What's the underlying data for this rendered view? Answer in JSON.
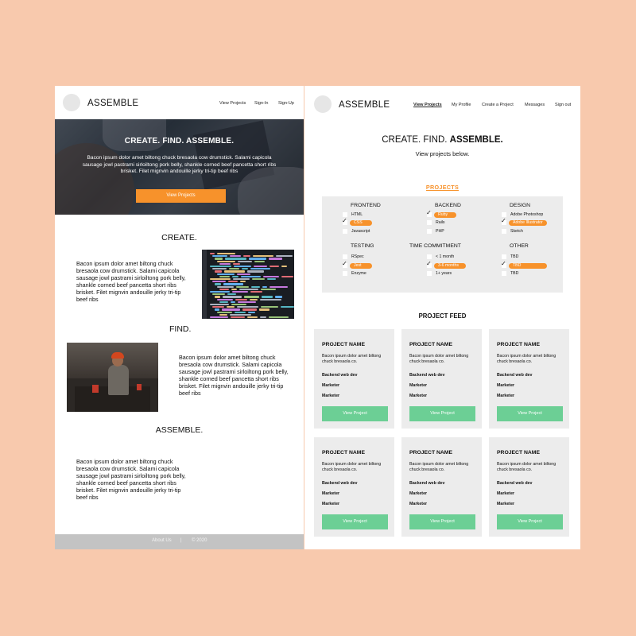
{
  "left": {
    "brand": "ASSEMBLE",
    "nav": [
      "View Projects",
      "Sign-In",
      "Sign-Up"
    ],
    "hero": {
      "title": "CREATE. FIND. ASSEMBLE.",
      "text": "Bacon ipsum dolor amet biltong chuck bresaola cow drumstick. Salami capicola sausage jowl pastrami sirloiltong pork belly, shankle corned beef pancetta short ribs brisket. Filet mignvin andouille jerky tri-tip beef ribs",
      "button": "View Projects"
    },
    "sections": [
      {
        "title": "CREATE.",
        "text": "Bacon ipsum dolor amet biltong chuck bresaola cow drumstick. Salami capicola sausage jowl pastrami sirloiltong pork belly, shankle corned beef pancetta short ribs brisket. Filet mignvin andouille jerky tri-tip beef ribs"
      },
      {
        "title": "FIND.",
        "text": "Bacon ipsum dolor amet biltong chuck bresaola cow drumstick. Salami capicola sausage jowl pastrami sirloiltong pork belly, shankle corned beef pancetta short ribs brisket. Filet mignvin andouille jerky tri-tip beef ribs"
      },
      {
        "title": "ASSEMBLE.",
        "text": "Bacon ipsum dolor amet biltong chuck bresaola cow drumstick. Salami capicola sausage jowl pastrami sirloiltong pork belly, shankle corned beef pancetta short ribs brisket. Filet mignvin andouille jerky tri-tip beef ribs"
      }
    ],
    "footer": {
      "about": "About Us",
      "sep": "|",
      "copyright": "© 2020"
    }
  },
  "right": {
    "brand": "ASSEMBLE",
    "nav": [
      "View Projects",
      "My Profile",
      "Create a Project",
      "Messages",
      "Sign out"
    ],
    "title_plain": "CREATE. FIND.",
    "title_bold": "ASSEMBLE.",
    "subtitle": "View projects below.",
    "projects_label": "PROJECTS",
    "filters": [
      {
        "heading": "FRONTEND",
        "options": [
          {
            "label": "HTML",
            "checked": false
          },
          {
            "label": "CSS",
            "checked": true
          },
          {
            "label": "Javascript",
            "checked": false
          }
        ]
      },
      {
        "heading": "BACKEND",
        "options": [
          {
            "label": "Ruby",
            "checked": true
          },
          {
            "label": "Rails",
            "checked": false
          },
          {
            "label": "PHP",
            "checked": false
          }
        ]
      },
      {
        "heading": "DESIGN",
        "options": [
          {
            "label": "Adobe Photoshop",
            "checked": false
          },
          {
            "label": "Adobe Illustrator",
            "checked": true
          },
          {
            "label": "Sketch",
            "checked": false
          }
        ]
      },
      {
        "heading": "TESTING",
        "options": [
          {
            "label": "RSpec",
            "checked": false
          },
          {
            "label": "Jest",
            "checked": true
          },
          {
            "label": "Enzyme",
            "checked": false
          }
        ]
      },
      {
        "heading": "TIME COMMITMENT",
        "options": [
          {
            "label": "< 1 month",
            "checked": false
          },
          {
            "label": "3-6 months",
            "checked": true
          },
          {
            "label": "1+ years",
            "checked": false
          }
        ]
      },
      {
        "heading": "OTHER",
        "options": [
          {
            "label": "TBD",
            "checked": false
          },
          {
            "label": "TBD",
            "checked": true
          },
          {
            "label": "TBD",
            "checked": false
          }
        ]
      }
    ],
    "feed_title": "PROJECT FEED",
    "cards": [
      {
        "name": "PROJECT NAME",
        "desc": "Bacon ipsum dolor amet biltong chuck bresaola co.",
        "roles": [
          "Backend web dev",
          "Marketer",
          "Marketer"
        ],
        "button": "View Project"
      },
      {
        "name": "PROJECT NAME",
        "desc": "Bacon ipsum dolor amet biltong chuck bresaola co.",
        "roles": [
          "Backend web dev",
          "Marketer",
          "Marketer"
        ],
        "button": "View Project"
      },
      {
        "name": "PROJECT NAME",
        "desc": "Bacon ipsum dolor amet biltong chuck bresaola co.",
        "roles": [
          "Backend web dev",
          "Marketer",
          "Marketer"
        ],
        "button": "View Project"
      },
      {
        "name": "PROJECT NAME",
        "desc": "Bacon ipsum dolor amet biltong chuck bresaola co.",
        "roles": [
          "Backend web dev",
          "Marketer",
          "Marketer"
        ],
        "button": "View Project"
      },
      {
        "name": "PROJECT NAME",
        "desc": "Bacon ipsum dolor amet biltong chuck bresaola co.",
        "roles": [
          "Backend web dev",
          "Marketer",
          "Marketer"
        ],
        "button": "View Project"
      },
      {
        "name": "PROJECT NAME",
        "desc": "Bacon ipsum dolor amet biltong chuck bresaola co.",
        "roles": [
          "Backend web dev",
          "Marketer",
          "Marketer"
        ],
        "button": "View Project"
      }
    ]
  },
  "colors": {
    "background": "#f8c9ad",
    "accent": "#f7922b",
    "button_green": "#6ccf95",
    "card_bg": "#ececec",
    "footer": "#c3c3c3"
  },
  "icons": {
    "logo": "logo-circle",
    "check": "checkmark-icon"
  }
}
